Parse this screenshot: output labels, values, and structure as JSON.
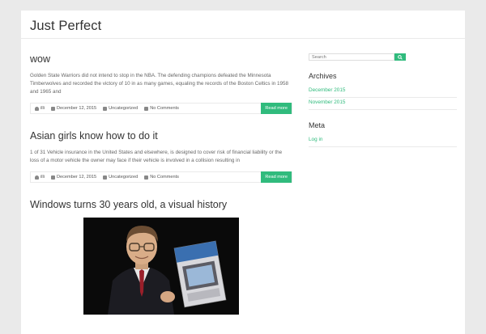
{
  "site": {
    "title": "Just Perfect"
  },
  "posts": [
    {
      "title": "wow",
      "excerpt": "Golden State Warriors did not intend to stop in the NBA. The defending champions defeated the Minnesota Timberwolves and recorded the victory of 10 in as many games, equaling the records of the Boston Celtics in 1958 and 1965 and",
      "author": "illi",
      "date": "December 12, 2015",
      "category": "Uncategorized",
      "comments": "No Comments",
      "read_more": "Read more"
    },
    {
      "title": "Asian girls know how to do it",
      "excerpt": "1 of 31 Vehicle insurance in the United States and elsewhere, is designed to cover risk of financial liability or the loss of a motor vehicle the owner may face if their vehicle is involved in a collision resulting in",
      "author": "illi",
      "date": "December 12, 2015",
      "category": "Uncategorized",
      "comments": "No Comments",
      "read_more": "Read more"
    },
    {
      "title": "Windows turns 30 years old, a visual history"
    }
  ],
  "sidebar": {
    "search_placeholder": "Search",
    "archives_title": "Archives",
    "archives": [
      "December 2015",
      "November 2015"
    ],
    "meta_title": "Meta",
    "meta_links": [
      "Log in"
    ]
  },
  "colors": {
    "accent": "#30bb7d",
    "background": "#eaeaea"
  },
  "icons": [
    "user-icon",
    "calendar-icon",
    "folder-icon",
    "comment-icon",
    "search-icon"
  ]
}
